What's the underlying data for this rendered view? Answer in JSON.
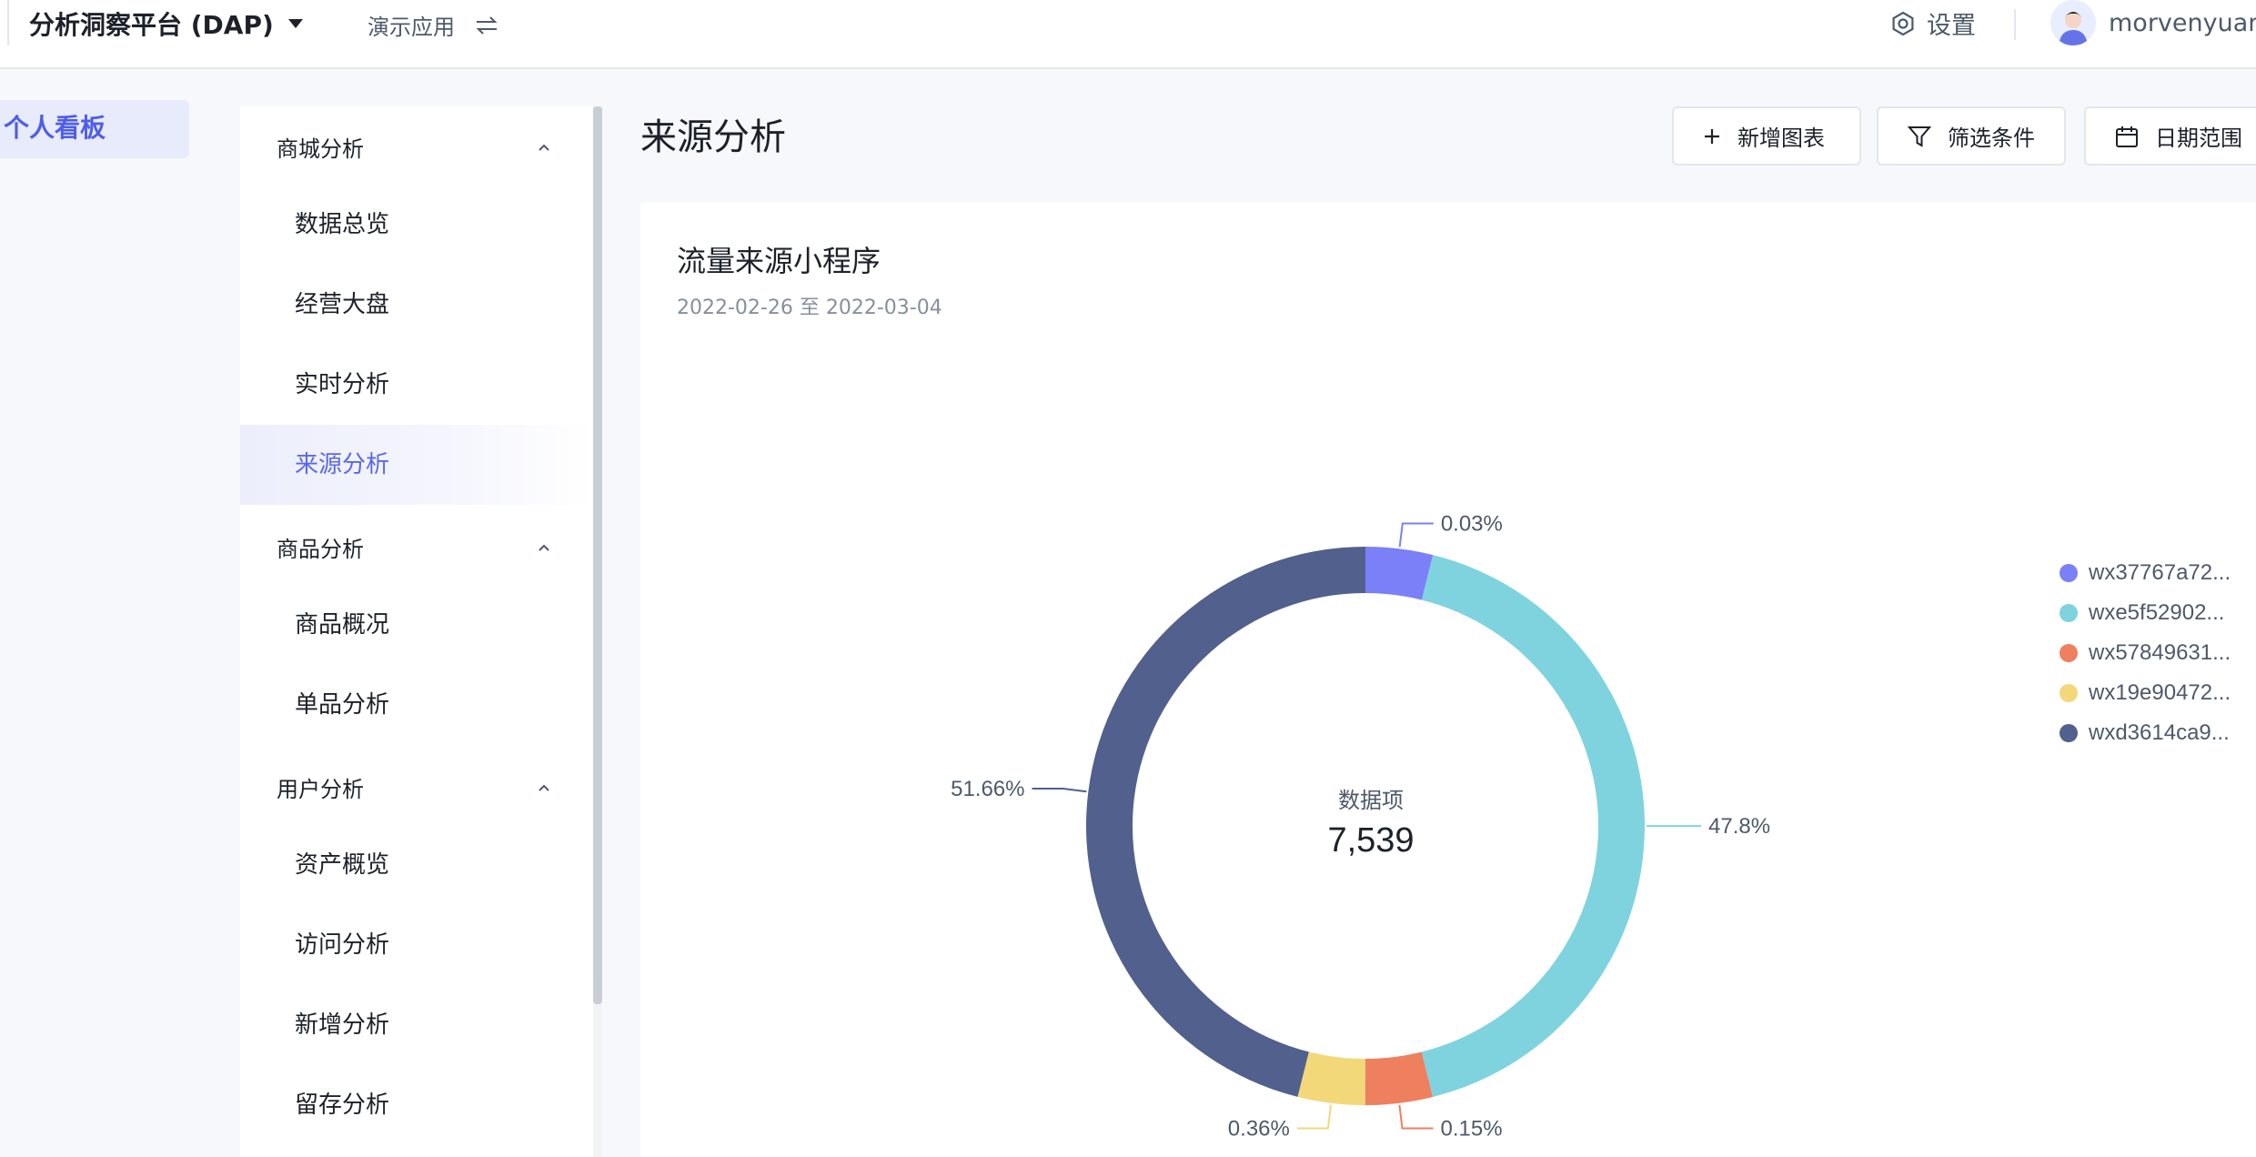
{
  "header": {
    "brand": "分析洞察平台 (DAP)",
    "app_name": "演示应用",
    "settings_label": "设置",
    "username": "morvenyuan"
  },
  "rail": {
    "items": [
      {
        "label": "个人看板",
        "active": true
      }
    ]
  },
  "subnav": {
    "groups": [
      {
        "title": "商城分析",
        "expanded": true,
        "items": [
          {
            "label": "数据总览"
          },
          {
            "label": "经营大盘"
          },
          {
            "label": "实时分析"
          },
          {
            "label": "来源分析",
            "active": true
          }
        ]
      },
      {
        "title": "商品分析",
        "expanded": true,
        "items": [
          {
            "label": "商品概况"
          },
          {
            "label": "单品分析"
          }
        ]
      },
      {
        "title": "用户分析",
        "expanded": true,
        "items": [
          {
            "label": "资产概览"
          },
          {
            "label": "访问分析"
          },
          {
            "label": "新增分析"
          },
          {
            "label": "留存分析"
          }
        ]
      }
    ]
  },
  "page": {
    "title": "来源分析",
    "buttons": {
      "add_chart": "新增图表",
      "filter": "筛选条件",
      "date_range": "日期范围"
    }
  },
  "card": {
    "title": "流量来源小程序",
    "date_range": "2022-02-26 至 2022-03-04"
  },
  "colors": {
    "accent": "#5b68e8"
  },
  "chart_data": {
    "type": "pie",
    "variant": "donut",
    "center_label": "数据项",
    "center_value": "7,539",
    "legend_position": "right",
    "series": [
      {
        "name": "wx37767a72...",
        "percent": 0.03,
        "label": "0.03%",
        "color": "#7b7ff8"
      },
      {
        "name": "wxe5f52902...",
        "percent": 47.8,
        "label": "47.8%",
        "color": "#7fd3df"
      },
      {
        "name": "wx57849631...",
        "percent": 0.15,
        "label": "0.15%",
        "color": "#ee7f5f"
      },
      {
        "name": "wx19e90472...",
        "percent": 0.36,
        "label": "0.36%",
        "color": "#f2d879"
      },
      {
        "name": "wxd3614ca9...",
        "percent": 51.66,
        "label": "51.66%",
        "color": "#51608c"
      }
    ]
  }
}
